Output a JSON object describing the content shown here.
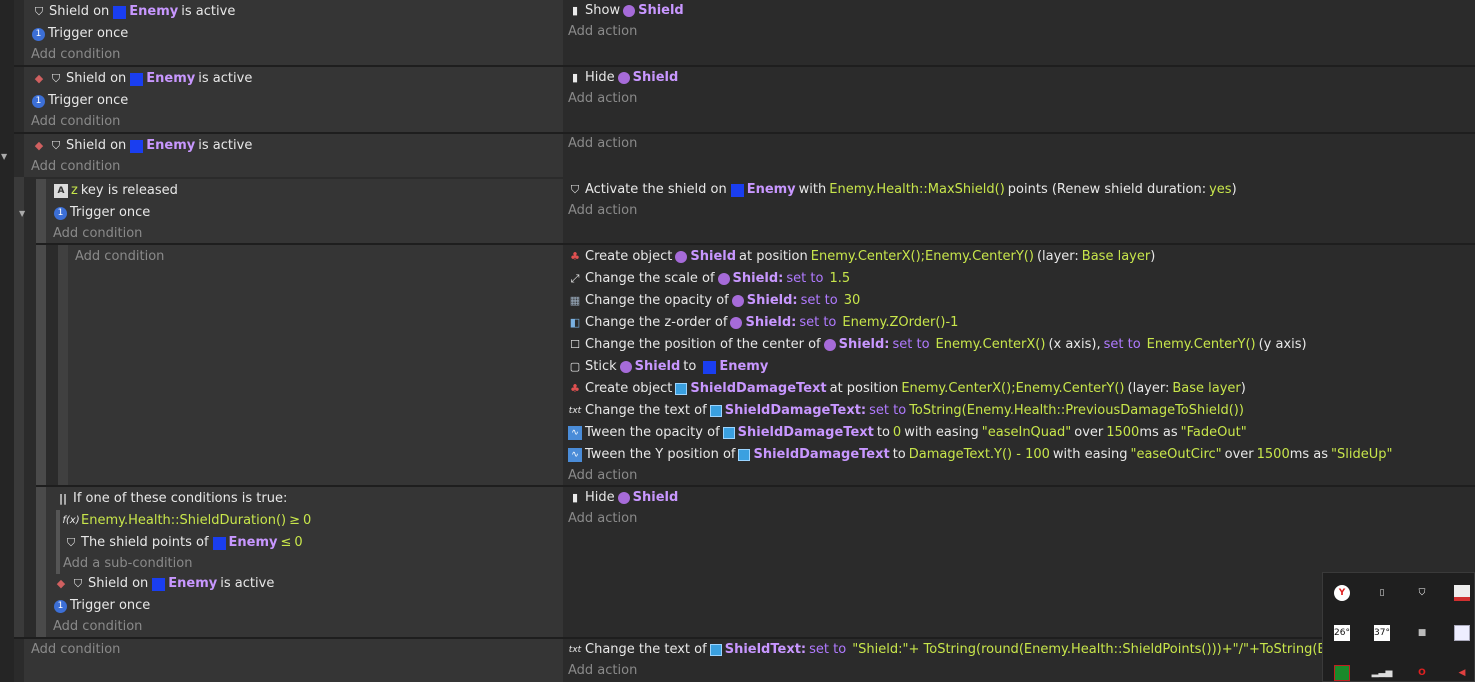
{
  "e1": {
    "cond_prefix": "Shield on",
    "cond_obj": "Enemy",
    "cond_suffix": "is active",
    "trigger": "Trigger once",
    "add_condition": "Add condition",
    "action_verb": "Show",
    "action_obj": "Shield",
    "add_action": "Add action"
  },
  "e2": {
    "cond_prefix": "Shield on",
    "cond_obj": "Enemy",
    "cond_suffix": "is active",
    "trigger": "Trigger once",
    "add_condition": "Add condition",
    "action_verb": "Hide",
    "action_obj": "Shield",
    "add_action": "Add action"
  },
  "e3": {
    "cond_prefix": "Shield on",
    "cond_obj": "Enemy",
    "cond_suffix": "is active",
    "add_condition": "Add condition",
    "add_action": "Add action"
  },
  "e4": {
    "key": "z",
    "key_suffix": "key is released",
    "trigger": "Trigger once",
    "add_condition": "Add condition",
    "a1_pre": "Activate the shield on",
    "a1_obj": "Enemy",
    "a1_mid": "with",
    "a1_val": "Enemy.Health::MaxShield()",
    "a1_post": "points (Renew shield duration:",
    "a1_yes": "yes",
    "a1_end": ")",
    "add_action": "Add action"
  },
  "e5": {
    "add_condition": "Add condition",
    "a1": {
      "pre": "Create object",
      "obj": "Shield",
      "mid": "at position",
      "val": "Enemy.CenterX();Enemy.CenterY()",
      "post": "(layer:",
      "layer": "Base layer",
      "end": ")"
    },
    "a2": {
      "pre": "Change the scale of",
      "obj": "Shield:",
      "kw": "set to",
      "val": "1.5"
    },
    "a3": {
      "pre": "Change the opacity of",
      "obj": "Shield:",
      "kw": "set to",
      "val": "30"
    },
    "a4": {
      "pre": "Change the z-order of",
      "obj": "Shield:",
      "kw": "set to",
      "val": "Enemy.ZOrder()-1"
    },
    "a5": {
      "pre": "Change the position of the center of",
      "obj": "Shield:",
      "kw": "set to",
      "val": "Enemy.CenterX()",
      "mid": "(x axis),",
      "kw2": "set to",
      "val2": "Enemy.CenterY()",
      "post": "(y axis)"
    },
    "a6": {
      "pre": "Stick",
      "obj": "Shield",
      "mid": "to",
      "obj2": "Enemy"
    },
    "a7": {
      "pre": "Create object",
      "obj": "ShieldDamageText",
      "mid": "at position",
      "val": "Enemy.CenterX();Enemy.CenterY()",
      "post": "(layer:",
      "layer": "Base layer",
      "end": ")"
    },
    "a8": {
      "pre": "Change the text of",
      "obj": "ShieldDamageText:",
      "kw": "set to",
      "val": "ToString(Enemy.Health::PreviousDamageToShield())"
    },
    "a9": {
      "pre": "Tween the opacity of",
      "obj": "ShieldDamageText",
      "mid": "to",
      "val": "0",
      "mid2": "with easing",
      "val2": "\"easeInQuad\"",
      "mid3": "over",
      "val3": "1500",
      "mid4": "ms as",
      "val4": "\"FadeOut\""
    },
    "a10": {
      "pre": "Tween the Y position of",
      "obj": "ShieldDamageText",
      "mid": "to",
      "val": "DamageText.Y() - 100",
      "mid2": "with easing",
      "val2": "\"easeOutCirc\"",
      "mid3": "over",
      "val3": "1500",
      "mid4": "ms as",
      "val4": "\"SlideUp\""
    },
    "add_action": "Add action"
  },
  "e6": {
    "or_label": "If one of these conditions is true:",
    "sub1": "Enemy.Health::ShieldDuration()",
    "sub1_op": "≥",
    "sub1_val": "0",
    "sub2_pre": "The shield points of",
    "sub2_obj": "Enemy",
    "sub2_op": "≤",
    "sub2_val": "0",
    "add_sub": "Add a sub-condition",
    "cond_prefix": "Shield on",
    "cond_obj": "Enemy",
    "cond_suffix": "is active",
    "trigger": "Trigger once",
    "add_condition": "Add condition",
    "action_verb": "Hide",
    "action_obj": "Shield",
    "add_action": "Add action"
  },
  "e7": {
    "add_condition": "Add condition",
    "a_pre": "Change the text of",
    "a_obj": "ShieldText:",
    "a_kw": "set to",
    "a_val": "\"Shield:\"+ ToString(round(Enemy.Health::ShieldPoints()))+\"/\"+ToString(Enemy.H",
    "add_action": "Add action"
  },
  "tray": {
    "badge1": "26°",
    "badge2": "37°"
  }
}
